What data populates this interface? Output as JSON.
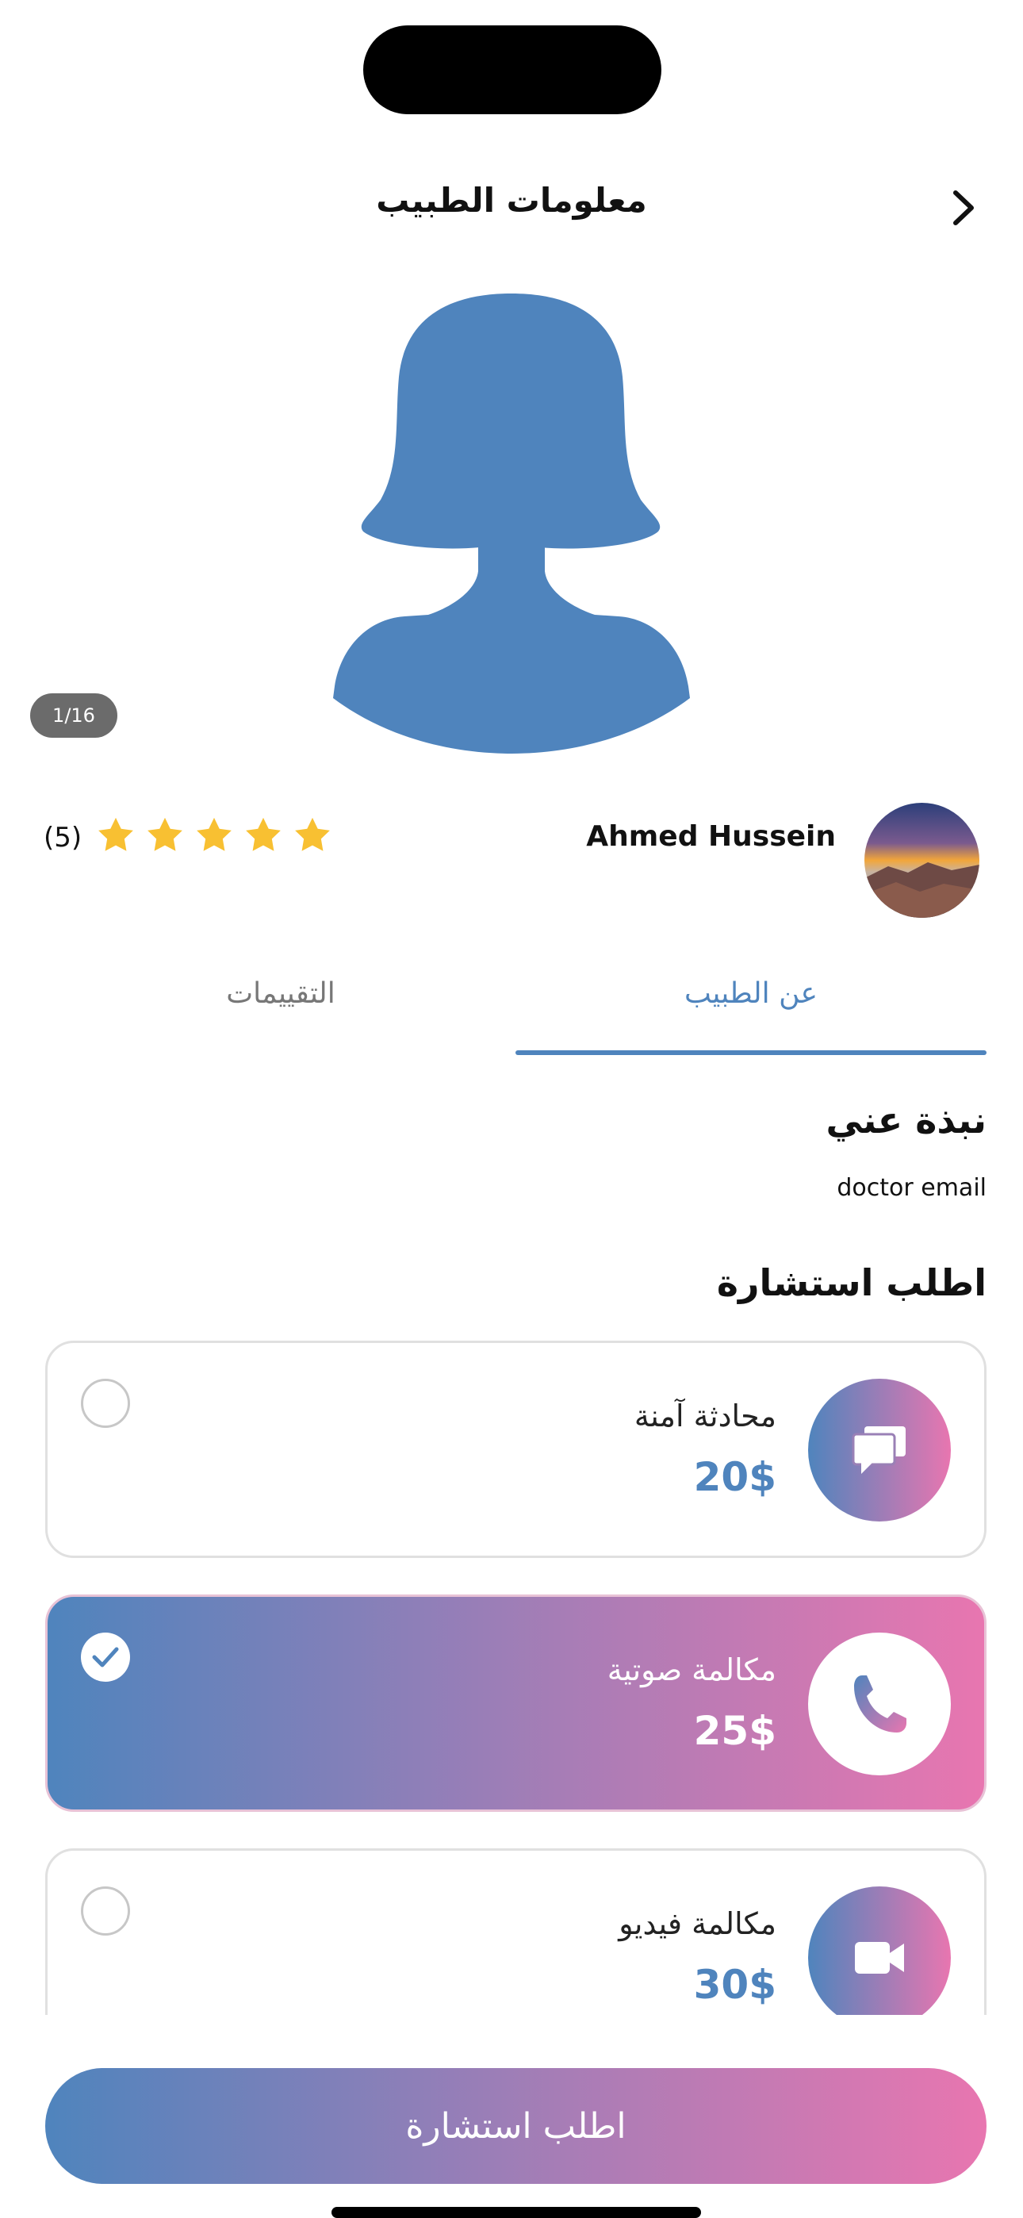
{
  "header": {
    "title": "معلومات الطبيب",
    "back_icon": "chevron-right-icon"
  },
  "gallery": {
    "pager": "1/16",
    "placeholder_icon": "female-avatar-icon"
  },
  "doctor": {
    "name": "Ahmed Hussein",
    "rating_count": "(5)",
    "rating": 5,
    "stars_total": 5
  },
  "tabs": [
    {
      "label": "عن الطبيب",
      "active": true
    },
    {
      "label": "التقييمات",
      "active": false
    }
  ],
  "bio": {
    "title": "نبذة عني",
    "text": "doctor email"
  },
  "consultation": {
    "title": "اطلب استشارة",
    "options": [
      {
        "label": "محادثة آمنة",
        "price": "20$",
        "icon": "chat-icon",
        "selected": false
      },
      {
        "label": "مكالمة صوتية",
        "price": "25$",
        "icon": "phone-icon",
        "selected": true
      },
      {
        "label": "مكالمة فيديو",
        "price": "30$",
        "icon": "video-camera-icon",
        "selected": false
      }
    ]
  },
  "cta": {
    "label": "اطلب استشارة"
  },
  "colors": {
    "accent_blue": "#4f84bd",
    "accent_pink": "#e876b0",
    "star": "#f8c032"
  }
}
